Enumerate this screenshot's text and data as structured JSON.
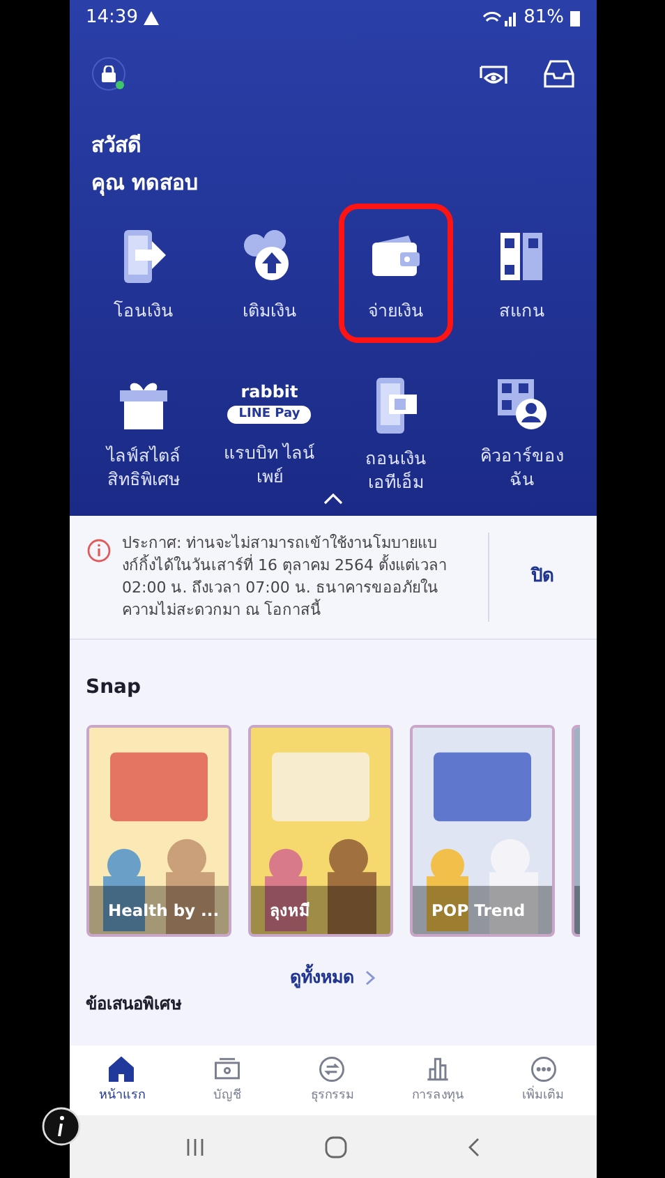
{
  "status_bar": {
    "time": "14:39",
    "battery": "81%"
  },
  "greeting": {
    "hello": "สวัสดี",
    "name": "คุณ ทดสอบ"
  },
  "services": [
    {
      "kind": "transfer",
      "label": "โอนเงิน",
      "highlighted": false
    },
    {
      "kind": "topup",
      "label": "เติมเงิน",
      "highlighted": false
    },
    {
      "kind": "wallet",
      "label": "จ่ายเงิน",
      "highlighted": true
    },
    {
      "kind": "scan",
      "label": "สแกน",
      "highlighted": false
    },
    {
      "kind": "gift",
      "label": "ไลฟ์สไตล์ สิทธิพิเศษ",
      "highlighted": false
    },
    {
      "kind": "rabbit",
      "logo_top": "rabbit",
      "logo_bottom": "LINE Pay",
      "label": "แรบบิท ไลน์เพย์",
      "highlighted": false
    },
    {
      "kind": "atm",
      "label": "ถอนเงิน เอทีเอ็ม",
      "highlighted": false
    },
    {
      "kind": "qr",
      "label": "คิวอาร์ของ ฉัน",
      "highlighted": false
    }
  ],
  "notice": {
    "text": "ประกาศ: ท่านจะไม่สามารถเข้าใช้งานโมบายแบงก์กิ้งได้ในวันเสาร์ที่ 16 ตุลาคม 2564 ตั้งแต่เวลา 02:00 น. ถึงเวลา 07:00 น. ธนาคารขออภัยในความไม่สะดวกมา ณ โอกาสนี้",
    "close": "ปิด"
  },
  "snap": {
    "title": "Snap",
    "cards": [
      {
        "kind": "picture",
        "title": "Health by ..."
      },
      {
        "kind": "picture",
        "title": "ลุงหมี"
      },
      {
        "kind": "picture",
        "title": "POP Trend"
      },
      {
        "kind": "picture"
      }
    ],
    "see_all": "ดูทั้งหมด"
  },
  "offers": {
    "title": "ข้อเสนอพิเศษ"
  },
  "bottom_nav": [
    {
      "kind": "home",
      "label": "หน้าแรก",
      "selected": true
    },
    {
      "kind": "account",
      "label": "บัญชี",
      "selected": false
    },
    {
      "kind": "transaction",
      "label": "ธุรกรรม",
      "selected": false
    },
    {
      "kind": "invest",
      "label": "การลงทุน",
      "selected": false
    },
    {
      "kind": "more",
      "label": "เพิ่มเติม",
      "selected": false
    }
  ]
}
